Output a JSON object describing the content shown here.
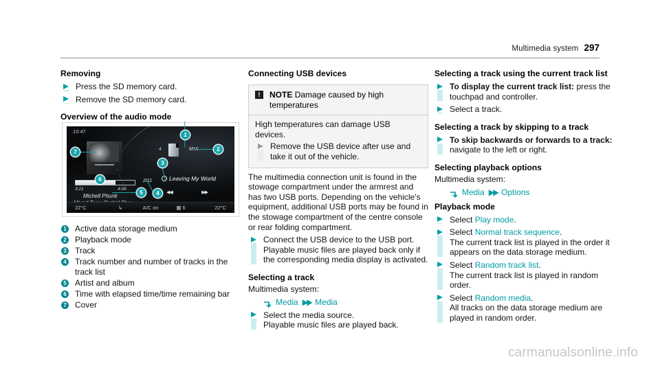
{
  "header": {
    "title": "Multimedia system",
    "page_number": "297"
  },
  "watermark": "carmanualsonline.info",
  "column_left": {
    "removing_heading": "Removing",
    "removing_steps": [
      "Press the SD memory card.",
      "Remove the SD memory card."
    ],
    "overview_heading": "Overview of the audio mode",
    "legend": [
      {
        "num": "1",
        "text": "Active data storage medium"
      },
      {
        "num": "2",
        "text": "Playback mode"
      },
      {
        "num": "3",
        "text": "Track"
      },
      {
        "num": "4",
        "text": "Track number and number of tracks in the track list"
      },
      {
        "num": "5",
        "text": "Artist and album"
      },
      {
        "num": "6",
        "text": "Time with elapsed time/time remaining bar"
      },
      {
        "num": "7",
        "text": "Cover"
      }
    ]
  },
  "figure": {
    "clock": "10:47",
    "elapsed_time": "3:21",
    "total_time": "4:06",
    "artist": "Michell Phunk",
    "album": "Mixed Tape Orchid Blue",
    "track_number": "2/11",
    "track_title": "Leaving My World",
    "playback_mode": "MIX",
    "source_count": "4",
    "prev_icon": "skip-back-icon",
    "next_icon": "skip-forward-icon",
    "cover_brand": "Mercedes-Benz",
    "statusbar": {
      "temp_left": "22°C",
      "seat_icon": "seat-heater-icon",
      "ac": "A/C on",
      "fan": "6",
      "fan_icon": "fan-icon",
      "temp_right": "22°C"
    }
  },
  "column_middle": {
    "usb_heading": "Connecting USB devices",
    "note": {
      "icon_glyph": "!",
      "label": "NOTE",
      "title": "Damage caused by high temperatures",
      "body": "High temperatures can damage USB devices.",
      "step": "Remove the USB device after use and take it out of the vehicle."
    },
    "paragraph": "The multimedia connection unit is found in the stowage compartment under the armrest and has two USB ports. Depending on the vehicle's equipment, additional USB ports may be found in the stowage compartment of the centre console or rear folding compartment.",
    "usb_step": "Connect the USB device to the USB port. Playable music files are played back only if the corresponding media display is activated.",
    "select_track_heading": "Selecting a track",
    "system_label": "Multimedia system:",
    "menu_path": {
      "enter_icon": "enter-menu-icon",
      "first": "Media",
      "next_icon": "next-level-icon",
      "second": "Media"
    },
    "select_step_bold": "",
    "select_step": "Select the media source.",
    "select_step_sub": "Playable music files are played back."
  },
  "column_right": {
    "track_list_heading": "Selecting a track using the current track list",
    "track_list_step_bold": "To display the current track list:",
    "track_list_step_rest": " press the touchpad and controller.",
    "track_list_step2": "Select a track.",
    "skip_heading": "Selecting a track by skipping to a track",
    "skip_step_bold": "To skip backwards or forwards to a track:",
    "skip_step_rest": " navigate to the left or right.",
    "playback_options_heading": "Selecting playback options",
    "system_label": "Multimedia system:",
    "menu_path": {
      "enter_icon": "enter-menu-icon",
      "first": "Media",
      "next_icon": "next-level-icon",
      "second": "Options"
    },
    "playback_mode_heading": "Playback mode",
    "steps": [
      {
        "prefix": "Select ",
        "link": "Play mode",
        "suffix": ".",
        "sub": ""
      },
      {
        "prefix": "Select ",
        "link": "Normal track sequence",
        "suffix": ".",
        "sub": "The current track list is played in the order it appears on the data storage medium."
      },
      {
        "prefix": "Select ",
        "link": "Random track list",
        "suffix": ".",
        "sub": "The current track list is played in random order."
      },
      {
        "prefix": "Select ",
        "link": "Random media",
        "suffix": ".",
        "sub": "All tracks on the data storage medium are played in random order."
      }
    ]
  },
  "colors": {
    "accent_teal": "#00a0a8",
    "accent_teal_dark": "#00868f",
    "bullet_bar": "#c9eef0",
    "note_bg": "#f4f4f4"
  }
}
